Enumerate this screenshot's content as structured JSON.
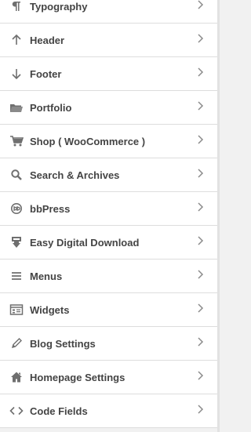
{
  "menu": {
    "items": [
      {
        "label": "Typography",
        "icon": "paragraph-icon"
      },
      {
        "label": "Header",
        "icon": "arrow-up-icon"
      },
      {
        "label": "Footer",
        "icon": "arrow-down-icon"
      },
      {
        "label": "Portfolio",
        "icon": "folder-icon"
      },
      {
        "label": "Shop ( WooCommerce )",
        "icon": "cart-icon"
      },
      {
        "label": "Search & Archives",
        "icon": "search-icon"
      },
      {
        "label": "bbPress",
        "icon": "bbpress-icon"
      },
      {
        "label": "Easy Digital Download",
        "icon": "download-icon"
      },
      {
        "label": "Menus",
        "icon": "menu-icon"
      },
      {
        "label": "Widgets",
        "icon": "widgets-icon"
      },
      {
        "label": "Blog Settings",
        "icon": "pencil-icon"
      },
      {
        "label": "Homepage Settings",
        "icon": "home-icon"
      },
      {
        "label": "Code Fields",
        "icon": "code-icon"
      }
    ]
  }
}
